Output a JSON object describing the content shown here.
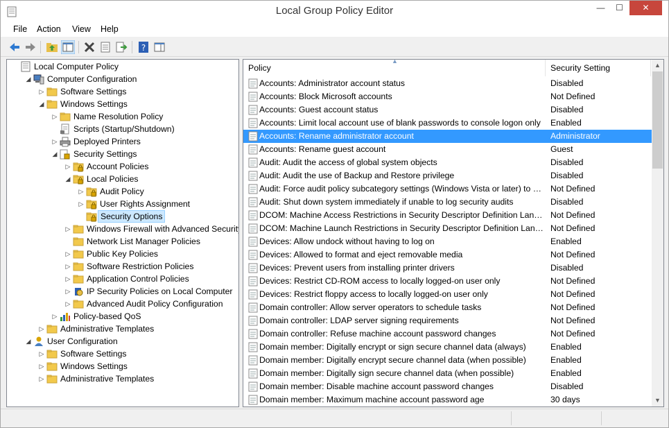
{
  "window": {
    "title": "Local Group Policy Editor",
    "min": "—",
    "max": "☐",
    "close": "✕"
  },
  "menu": [
    "File",
    "Action",
    "View",
    "Help"
  ],
  "toolbar": [
    {
      "name": "back-button",
      "icon": "arrow-left-icon"
    },
    {
      "name": "forward-button",
      "icon": "arrow-right-icon"
    },
    {
      "name": "up-one-level-button",
      "icon": "folder-up-icon"
    },
    {
      "name": "show-hide-console-tree-button",
      "icon": "console-tree-icon"
    },
    {
      "name": "delete-button",
      "icon": "x-icon"
    },
    {
      "name": "properties-button",
      "icon": "properties-icon"
    },
    {
      "name": "export-list-button",
      "icon": "export-icon"
    },
    {
      "name": "help-button",
      "icon": "help-icon"
    },
    {
      "name": "show-hide-action-pane-button",
      "icon": "action-pane-icon"
    }
  ],
  "tree": [
    {
      "label": "Local Computer Policy",
      "level": 0,
      "icon": "policy-doc-icon",
      "expander": ""
    },
    {
      "label": "Computer Configuration",
      "level": 1,
      "icon": "computer-icon",
      "expander": "expanded"
    },
    {
      "label": "Software Settings",
      "level": 2,
      "icon": "folder-icon",
      "expander": "collapsed"
    },
    {
      "label": "Windows Settings",
      "level": 2,
      "icon": "folder-icon",
      "expander": "expanded"
    },
    {
      "label": "Name Resolution Policy",
      "level": 3,
      "icon": "folder-icon",
      "expander": "collapsed"
    },
    {
      "label": "Scripts (Startup/Shutdown)",
      "level": 3,
      "icon": "script-icon",
      "expander": ""
    },
    {
      "label": "Deployed Printers",
      "level": 3,
      "icon": "printer-icon",
      "expander": "collapsed"
    },
    {
      "label": "Security Settings",
      "level": 3,
      "icon": "security-folder-icon",
      "expander": "expanded"
    },
    {
      "label": "Account Policies",
      "level": 4,
      "icon": "folder-lock-icon",
      "expander": "collapsed"
    },
    {
      "label": "Local Policies",
      "level": 4,
      "icon": "folder-lock-icon",
      "expander": "expanded"
    },
    {
      "label": "Audit Policy",
      "level": 5,
      "icon": "folder-lock-icon",
      "expander": "collapsed"
    },
    {
      "label": "User Rights Assignment",
      "level": 5,
      "icon": "folder-lock-icon",
      "expander": "collapsed"
    },
    {
      "label": "Security Options",
      "level": 5,
      "icon": "folder-lock-icon",
      "expander": "",
      "selected": true
    },
    {
      "label": "Windows Firewall with Advanced Security",
      "level": 4,
      "icon": "folder-icon",
      "expander": "collapsed"
    },
    {
      "label": "Network List Manager Policies",
      "level": 4,
      "icon": "folder-icon",
      "expander": ""
    },
    {
      "label": "Public Key Policies",
      "level": 4,
      "icon": "folder-icon",
      "expander": "collapsed"
    },
    {
      "label": "Software Restriction Policies",
      "level": 4,
      "icon": "folder-icon",
      "expander": "collapsed"
    },
    {
      "label": "Application Control Policies",
      "level": 4,
      "icon": "folder-icon",
      "expander": "collapsed"
    },
    {
      "label": "IP Security Policies on Local Computer",
      "level": 4,
      "icon": "ipsec-icon",
      "expander": "collapsed"
    },
    {
      "label": "Advanced Audit Policy Configuration",
      "level": 4,
      "icon": "folder-icon",
      "expander": "collapsed"
    },
    {
      "label": "Policy-based QoS",
      "level": 3,
      "icon": "qos-chart-icon",
      "expander": "collapsed"
    },
    {
      "label": "Administrative Templates",
      "level": 2,
      "icon": "folder-icon",
      "expander": "collapsed"
    },
    {
      "label": "User Configuration",
      "level": 1,
      "icon": "user-icon",
      "expander": "expanded"
    },
    {
      "label": "Software Settings",
      "level": 2,
      "icon": "folder-icon",
      "expander": "collapsed"
    },
    {
      "label": "Windows Settings",
      "level": 2,
      "icon": "folder-icon",
      "expander": "collapsed"
    },
    {
      "label": "Administrative Templates",
      "level": 2,
      "icon": "folder-icon",
      "expander": "collapsed"
    }
  ],
  "list": {
    "headers": {
      "policy": "Policy",
      "setting": "Security Setting"
    },
    "selected_index": 4,
    "rows": [
      {
        "policy": "Accounts: Administrator account status",
        "setting": "Disabled"
      },
      {
        "policy": "Accounts: Block Microsoft accounts",
        "setting": "Not Defined"
      },
      {
        "policy": "Accounts: Guest account status",
        "setting": "Disabled"
      },
      {
        "policy": "Accounts: Limit local account use of blank passwords to console logon only",
        "setting": "Enabled"
      },
      {
        "policy": "Accounts: Rename administrator account",
        "setting": "Administrator"
      },
      {
        "policy": "Accounts: Rename guest account",
        "setting": "Guest"
      },
      {
        "policy": "Audit: Audit the access of global system objects",
        "setting": "Disabled"
      },
      {
        "policy": "Audit: Audit the use of Backup and Restore privilege",
        "setting": "Disabled"
      },
      {
        "policy": "Audit: Force audit policy subcategory settings (Windows Vista or later) to ov...",
        "setting": "Not Defined"
      },
      {
        "policy": "Audit: Shut down system immediately if unable to log security audits",
        "setting": "Disabled"
      },
      {
        "policy": "DCOM: Machine Access Restrictions in Security Descriptor Definition Langua...",
        "setting": "Not Defined"
      },
      {
        "policy": "DCOM: Machine Launch Restrictions in Security Descriptor Definition Langu...",
        "setting": "Not Defined"
      },
      {
        "policy": "Devices: Allow undock without having to log on",
        "setting": "Enabled"
      },
      {
        "policy": "Devices: Allowed to format and eject removable media",
        "setting": "Not Defined"
      },
      {
        "policy": "Devices: Prevent users from installing printer drivers",
        "setting": "Disabled"
      },
      {
        "policy": "Devices: Restrict CD-ROM access to locally logged-on user only",
        "setting": "Not Defined"
      },
      {
        "policy": "Devices: Restrict floppy access to locally logged-on user only",
        "setting": "Not Defined"
      },
      {
        "policy": "Domain controller: Allow server operators to schedule tasks",
        "setting": "Not Defined"
      },
      {
        "policy": "Domain controller: LDAP server signing requirements",
        "setting": "Not Defined"
      },
      {
        "policy": "Domain controller: Refuse machine account password changes",
        "setting": "Not Defined"
      },
      {
        "policy": "Domain member: Digitally encrypt or sign secure channel data (always)",
        "setting": "Enabled"
      },
      {
        "policy": "Domain member: Digitally encrypt secure channel data (when possible)",
        "setting": "Enabled"
      },
      {
        "policy": "Domain member: Digitally sign secure channel data (when possible)",
        "setting": "Enabled"
      },
      {
        "policy": "Domain member: Disable machine account password changes",
        "setting": "Disabled"
      },
      {
        "policy": "Domain member: Maximum machine account password age",
        "setting": "30 days"
      }
    ]
  },
  "colors": {
    "selection": "#3399ff",
    "close_button": "#c7463c",
    "folder": "#f2c94c"
  }
}
